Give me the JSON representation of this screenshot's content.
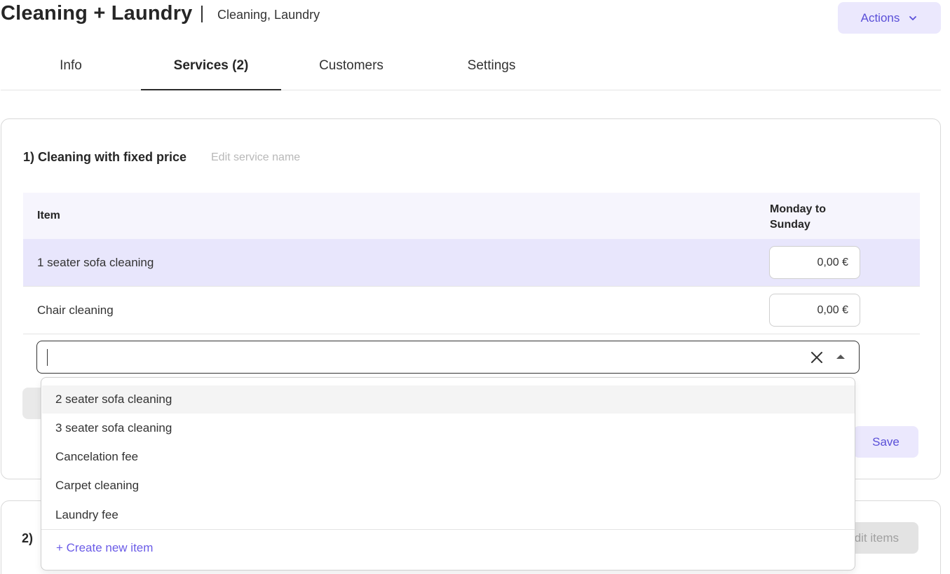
{
  "header": {
    "title": "Cleaning + Laundry",
    "subtitle": "Cleaning, Laundry",
    "actions_label": "Actions"
  },
  "tabs": [
    {
      "label": "Info"
    },
    {
      "label": "Services (2)"
    },
    {
      "label": "Customers"
    },
    {
      "label": "Settings"
    }
  ],
  "service1": {
    "title": "1) Cleaning with fixed price",
    "edit_label": "Edit service name",
    "table": {
      "col_item": "Item",
      "col_price": "Monday to Sunday",
      "rows": [
        {
          "label": "1 seater sofa cleaning",
          "price": "0,00 €"
        },
        {
          "label": "Chair cleaning",
          "price": "0,00 €"
        }
      ]
    },
    "save_label": "Save"
  },
  "service2": {
    "title": "2)",
    "edit_items_label": "Edit items"
  },
  "dropdown": {
    "options": [
      "2 seater sofa cleaning",
      "3 seater sofa cleaning",
      "Cancelation fee",
      "Carpet cleaning",
      "Laundry fee"
    ],
    "create_label": "+ Create new item"
  },
  "colors": {
    "accent": "#5a4fd8",
    "accent_bg": "#ebe8fd",
    "row_highlight": "#e8e6fc"
  }
}
